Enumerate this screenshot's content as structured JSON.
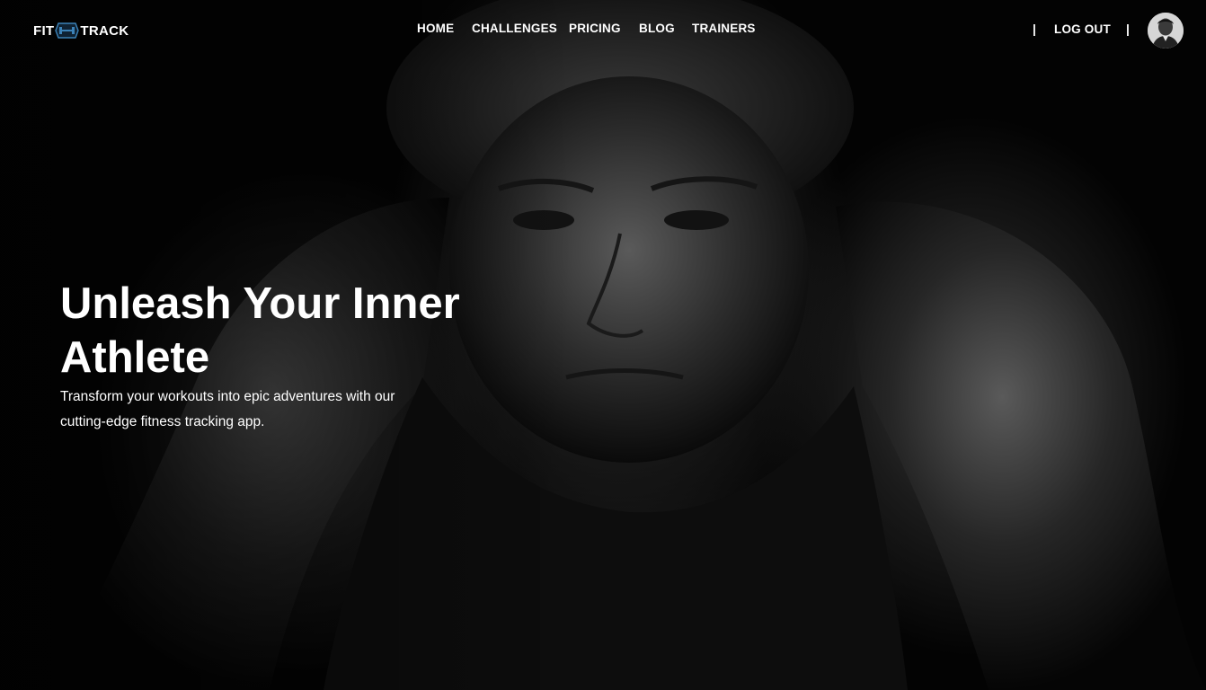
{
  "brand": {
    "left": "FIT",
    "right": "TRACK",
    "icon": "dumbbell-icon",
    "accent_color": "#3b82b8"
  },
  "nav": {
    "items": [
      {
        "label": "HOME"
      },
      {
        "label": "CHALLENGES"
      },
      {
        "label": "PRICING"
      },
      {
        "label": "BLOG"
      },
      {
        "label": "TRAINERS"
      }
    ],
    "separator": "|",
    "logout_label": "LOG OUT",
    "avatar_icon": "user-avatar"
  },
  "hero": {
    "title": "Unleash Your Inner Athlete",
    "subtitle": "Transform your workouts into epic adventures with our cutting-edge fitness tracking app."
  }
}
